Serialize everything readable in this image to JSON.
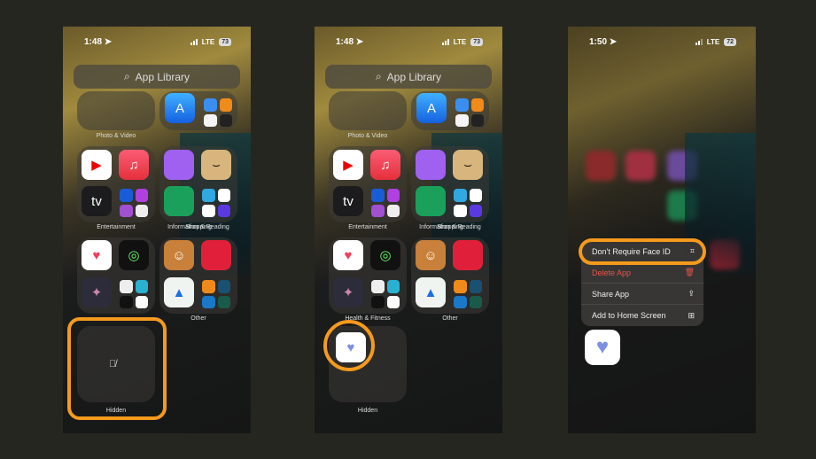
{
  "accent": "#f59a1d",
  "panels": [
    {
      "time": "1:48",
      "network": "LTE",
      "battery": "73",
      "search_placeholder": "App Library",
      "folders": [
        "Photo & Video",
        "Information & Reading",
        "Entertainment",
        "Shopping",
        "",
        "Other",
        "Hidden"
      ],
      "highlight": "hidden-folder",
      "hidden_icon": "eye-slash-icon"
    },
    {
      "time": "1:48",
      "network": "LTE",
      "battery": "73",
      "search_placeholder": "App Library",
      "folders": [
        "Photo & Video",
        "Information & Reading",
        "Entertainment",
        "Shopping",
        "Health & Fitness",
        "Other",
        "Hidden"
      ],
      "highlight": "health-app-in-hidden"
    }
  ],
  "panel3": {
    "time": "1:50",
    "network": "LTE",
    "battery": "72",
    "menu": [
      {
        "label": "Don't Require Face ID",
        "icon": "face-id-icon",
        "highlighted": true
      },
      {
        "label": "Delete App",
        "icon": "trash-icon",
        "destructive": true
      },
      {
        "label": "Share App",
        "icon": "share-icon"
      },
      {
        "label": "Add to Home Screen",
        "icon": "add-square-icon"
      }
    ]
  }
}
